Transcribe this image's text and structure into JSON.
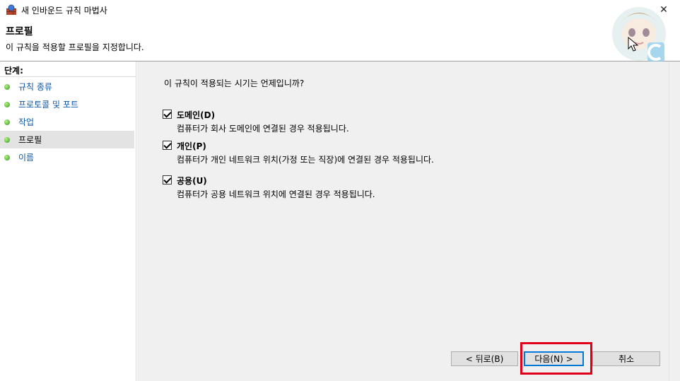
{
  "window": {
    "title": "새 인바운드 규칙 마법사",
    "close_glyph": "✕"
  },
  "header": {
    "title": "프로필",
    "description": "이 규칙을 적용할 프로필을 지정합니다."
  },
  "sidebar": {
    "heading": "단계:",
    "steps": [
      {
        "label": "규칙 종류"
      },
      {
        "label": "프로토콜 및 포트"
      },
      {
        "label": "작업"
      },
      {
        "label": "프로필",
        "current": true
      },
      {
        "label": "이름"
      }
    ]
  },
  "main": {
    "question": "이 규칙이 적용되는 시기는 언제입니까?",
    "options": [
      {
        "label": "도메인(D)",
        "description": "컴퓨터가 회사 도메인에 연결된 경우 적용됩니다.",
        "checked": true
      },
      {
        "label": "개인(P)",
        "description": "컴퓨터가 개인 네트워크 위치(가정 또는 직장)에 연결된 경우 적용됩니다.",
        "checked": true
      },
      {
        "label": "공용(U)",
        "description": "컴퓨터가 공용 네트워크 위치에 연결된 경우 적용됩니다.",
        "checked": true
      }
    ]
  },
  "buttons": {
    "back": "< 뒤로(B)",
    "next": "다음(N) >",
    "cancel": "취소"
  },
  "colors": {
    "highlight": "#e0001a",
    "link": "#0d56a8",
    "accent": "#0078d7",
    "bullet": "#2e9a12"
  },
  "icons": {
    "app": "firewall-icon",
    "close": "close-icon",
    "step": "green-bullet-icon"
  }
}
